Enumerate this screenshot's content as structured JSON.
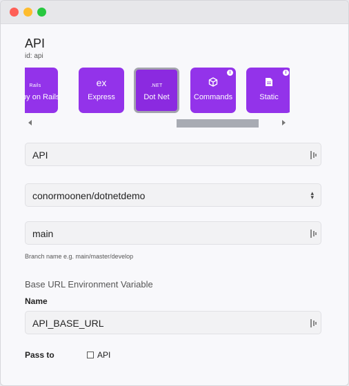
{
  "page": {
    "title": "API",
    "subtitle": "id: api"
  },
  "frameworks": [
    {
      "label": "Ruby on Rails",
      "icon": "rails-icon",
      "glyph": "Rails",
      "info": false,
      "selected": false
    },
    {
      "label": "Express",
      "icon": "express-icon",
      "glyph": "ex",
      "info": false,
      "selected": false
    },
    {
      "label": "Dot Net",
      "icon": "dotnet-icon",
      "glyph": ".NET",
      "info": false,
      "selected": true
    },
    {
      "label": "Commands",
      "icon": "cube-icon",
      "glyph": "⬡",
      "info": true,
      "selected": false
    },
    {
      "label": "Static",
      "icon": "file-icon",
      "glyph": "▮",
      "info": true,
      "selected": false
    }
  ],
  "form": {
    "name_value": "API",
    "repo_value": "conormoonen/dotnetdemo",
    "branch_value": "main",
    "branch_help": "Branch name e.g. main/master/develop",
    "base_url_heading": "Base URL Environment Variable",
    "env_name_label": "Name",
    "env_name_value": "API_BASE_URL",
    "pass_to_label": "Pass to",
    "pass_to_option": "API",
    "pass_to_checked": false
  },
  "colors": {
    "tile": "#9333ea",
    "tile_selected_border": "#a3a3ad"
  }
}
